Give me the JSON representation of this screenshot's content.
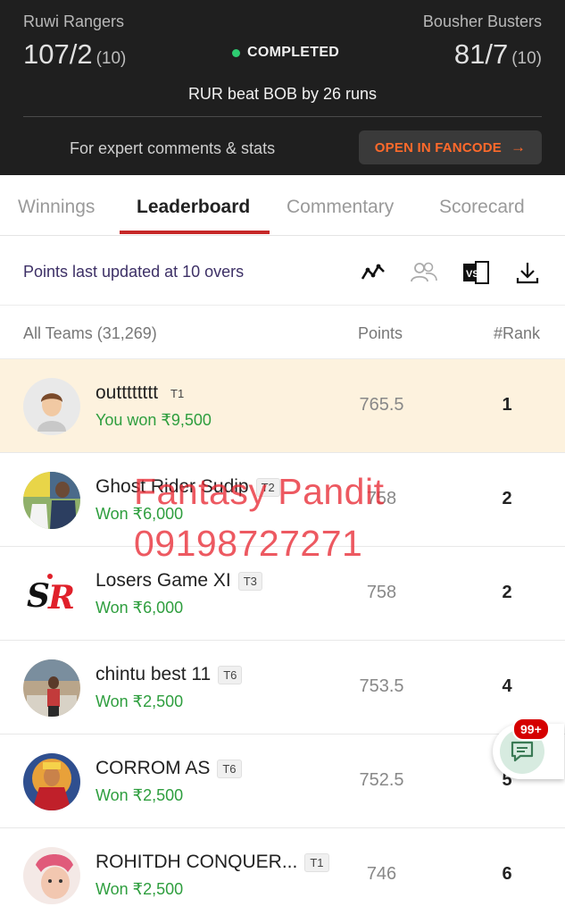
{
  "match": {
    "team1": {
      "name": "Ruwi Rangers",
      "score": "107/2",
      "overs": "(10)"
    },
    "team2": {
      "name": "Bousher Busters",
      "score": "81/7",
      "overs": "(10)"
    },
    "status": "COMPLETED",
    "status_color": "#2ecc71",
    "result": "RUR beat BOB by 26 runs",
    "expert_text": "For expert comments & stats",
    "fancode_button": "OPEN IN FANCODE",
    "fancode_arrow": "→"
  },
  "tabs": [
    {
      "label": "Winnings",
      "active": false
    },
    {
      "label": "Leaderboard",
      "active": true
    },
    {
      "label": "Commentary",
      "active": false
    },
    {
      "label": "Scorecard",
      "active": false
    }
  ],
  "update": {
    "text": "Points last updated at 10 overs",
    "icons": [
      "trend-chart-icon",
      "compare-teams-icon",
      "excel-export-icon",
      "download-icon"
    ]
  },
  "list_header": {
    "teams": "All Teams (31,269)",
    "points": "Points",
    "rank": "#Rank"
  },
  "entries": [
    {
      "name": "outttttttt",
      "tag": "T1",
      "winnings": "You won ₹9,500",
      "points": "765.5",
      "rank": "1"
    },
    {
      "name": "Ghost Rider Sudip",
      "tag": "T2",
      "winnings": "Won ₹6,000",
      "points": "758",
      "rank": "2"
    },
    {
      "name": "Losers Game XI",
      "tag": "T3",
      "winnings": "Won ₹6,000",
      "points": "758",
      "rank": "2"
    },
    {
      "name": "chintu best 11",
      "tag": "T6",
      "winnings": "Won ₹2,500",
      "points": "753.5",
      "rank": "4"
    },
    {
      "name": "CORROM AS",
      "tag": "T6",
      "winnings": "Won ₹2,500",
      "points": "752.5",
      "rank": "5"
    },
    {
      "name": "ROHITDH CONQUER...",
      "tag": "T1",
      "winnings": "Won ₹2,500",
      "points": "746",
      "rank": "6"
    }
  ],
  "watermark": {
    "line1": "Fantasy Pandit",
    "line2": "09198727271"
  },
  "chat": {
    "badge": "99+"
  },
  "colors": {
    "accent_red": "#c62828",
    "win_green": "#2e9e3e",
    "fancode_orange": "#ff6a2b",
    "highlight_row": "#fdf2de"
  }
}
